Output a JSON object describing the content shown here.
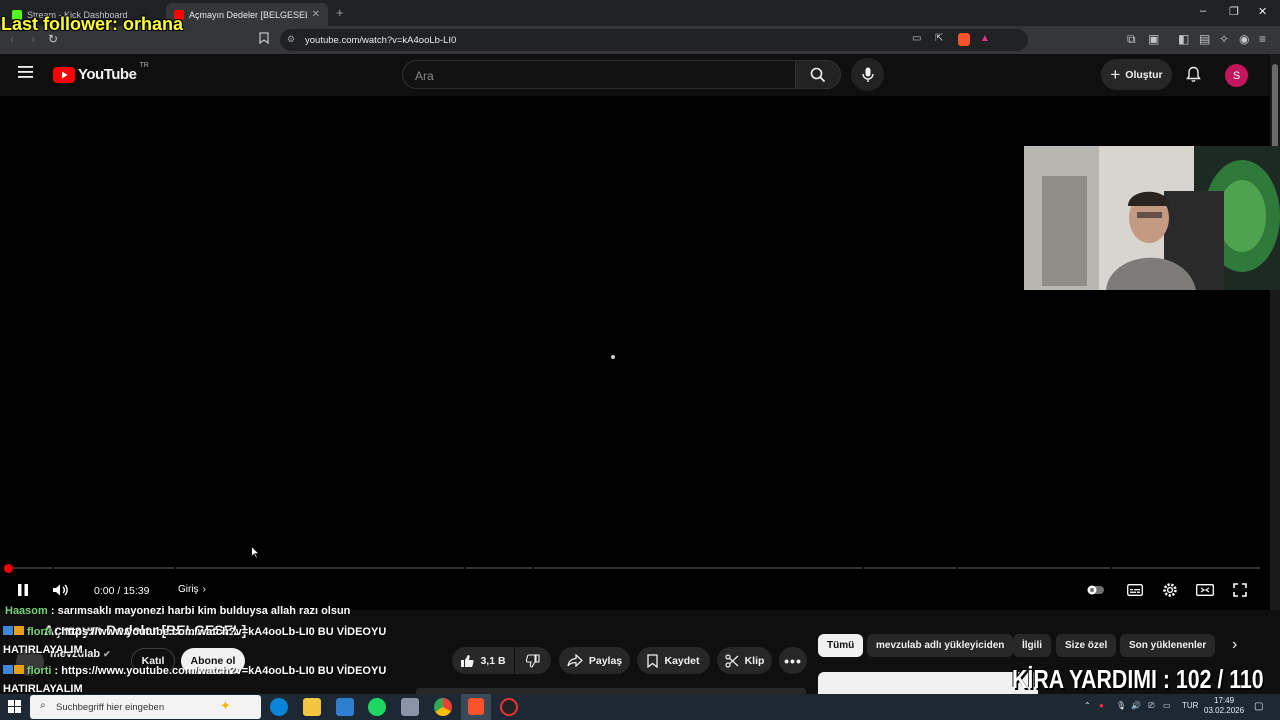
{
  "browser": {
    "tabs": [
      {
        "label": "Stream - Kick Dashboard"
      },
      {
        "label": "Açmayın Dedeler [BELGESEL] - Yo"
      }
    ],
    "url": "youtube.com/watch?v=kA4ooLb-LI0"
  },
  "youtube": {
    "logo": "YouTube",
    "region": "TR",
    "search_placeholder": "Ara",
    "create_label": "Oluştur",
    "avatar_letter": "S"
  },
  "player": {
    "time": "0:00 / 15:39",
    "chapter": "Giriş",
    "progress_fraction": 0.0
  },
  "overlay": {
    "last_follower": "Last follower: orhana",
    "counter": "KİRA YARDIMI : 102 / 110"
  },
  "chat": [
    {
      "user": "Haasom",
      "text": " : sarımsaklı mayonezi harbi kim bulduysa allah razı olsun"
    },
    {
      "user": "florti",
      "text": " : https://www.youtube.com/watch?v=kA4ooLb-LI0 BU VİDEOYU"
    },
    {
      "user": "",
      "text": "HATIRLAYALIM"
    },
    {
      "user": "florti",
      "text": " : https://www.youtube.com/watch?v=kA4ooLb-LI0 BU VİDEOYU"
    },
    {
      "user": "",
      "text": "HATIRLAYALIM"
    }
  ],
  "video_info": {
    "title": "Açmayın Dedeler [BELGESEL]",
    "channel": "mevzulab",
    "join_label": "Katıl",
    "subscribe_label": "Abone ol",
    "likes": "3,1 B",
    "share_label": "Paylaş",
    "save_label": "Kaydet",
    "clip_label": "Klip"
  },
  "chips": [
    "Tümü",
    "mevzulab adlı yükleyiciden",
    "İlgili",
    "Size özel",
    "Son yüklenenler"
  ],
  "taskbar": {
    "search_placeholder": "Suchbegriff hier eingeben",
    "lang": "TUR",
    "time": "17:49",
    "date": "03.02.2026"
  }
}
